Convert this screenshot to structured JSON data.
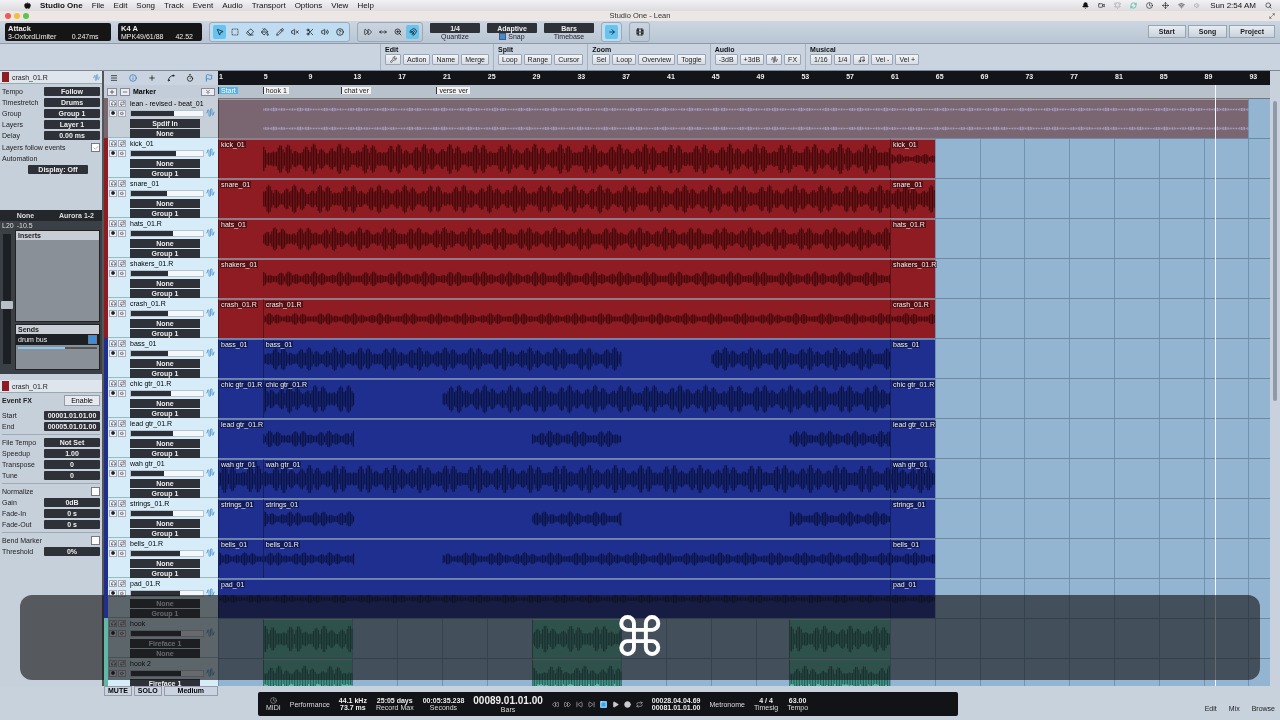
{
  "menu": {
    "app": "Studio One",
    "items": [
      "File",
      "Edit",
      "Song",
      "Track",
      "Event",
      "Audio",
      "Transport",
      "Options",
      "View",
      "Help"
    ],
    "clock": "Sun 2:54 AM"
  },
  "window": {
    "title": "Studio One - Lean"
  },
  "toolbar": {
    "instrument": {
      "name": "Attack",
      "plugin": "3-OxfordLimiter",
      "value": "0.247ms"
    },
    "device": {
      "name": "K4 A",
      "controller": "MPK49/61/88",
      "value": "42.52"
    },
    "tools": [
      {
        "kind": "arrow",
        "selected": true
      },
      {
        "kind": "range",
        "selected": false
      },
      {
        "kind": "split",
        "selected": false
      },
      {
        "kind": "paint",
        "selected": false
      },
      {
        "kind": "pencil",
        "selected": false
      },
      {
        "kind": "mute",
        "selected": false
      },
      {
        "kind": "bend",
        "selected": false
      },
      {
        "kind": "listen",
        "selected": false
      }
    ],
    "edit_tools": [
      {
        "kind": "forward",
        "selected": false
      },
      {
        "kind": "shift",
        "selected": false
      },
      {
        "kind": "zoom",
        "selected": false
      },
      {
        "kind": "follow",
        "selected": true
      }
    ],
    "quantize": {
      "value": "1/4",
      "label": "Quantize"
    },
    "snap": {
      "value": "Adaptive",
      "label": "Snap",
      "on": true
    },
    "timebase": {
      "value": "Bars",
      "label": "Timebase"
    },
    "pages": [
      "Start",
      "Song",
      "Project"
    ]
  },
  "macros": [
    {
      "title": "Edit",
      "buttons": [
        {
          "kind": "wrench"
        },
        {
          "kind": "text",
          "label": "Action"
        },
        {
          "kind": "text",
          "label": "Name"
        },
        {
          "kind": "text",
          "label": "Merge"
        }
      ]
    },
    {
      "title": "Split",
      "buttons": [
        {
          "kind": "text",
          "label": "Loop"
        },
        {
          "kind": "text",
          "label": "Range"
        },
        {
          "kind": "text",
          "label": "Cursor"
        }
      ]
    },
    {
      "title": "Zoom",
      "buttons": [
        {
          "kind": "text",
          "label": "Sel"
        },
        {
          "kind": "text",
          "label": "Loop"
        },
        {
          "kind": "text",
          "label": "Overview"
        },
        {
          "kind": "text",
          "label": "Toggle"
        }
      ]
    },
    {
      "title": "Audio",
      "buttons": [
        {
          "kind": "text",
          "label": "-3dB"
        },
        {
          "kind": "text",
          "label": "+3dB"
        },
        {
          "kind": "wave"
        },
        {
          "kind": "text",
          "label": "FX"
        }
      ]
    },
    {
      "title": "Musical",
      "buttons": [
        {
          "kind": "text",
          "label": "1/16"
        },
        {
          "kind": "text",
          "label": "1/4"
        },
        {
          "kind": "note"
        },
        {
          "kind": "text",
          "label": "Vel -"
        },
        {
          "kind": "text",
          "label": "Vel +"
        }
      ]
    }
  ],
  "inspector": {
    "track_name": "crash_01.R",
    "props": [
      {
        "label": "Tempo",
        "value": "Follow"
      },
      {
        "label": "Timestretch",
        "value": "Drums"
      },
      {
        "label": "Group",
        "value": "Group 1"
      },
      {
        "label": "Layers",
        "value": "Layer 1"
      },
      {
        "label": "Delay",
        "value": "0.00 ms"
      }
    ],
    "layers_follow": {
      "label": "Layers follow events",
      "checked": true
    },
    "automation": "Automation",
    "display": "Display: Off",
    "channel": {
      "input": "None",
      "output": "Aurora 1-2",
      "pan": "L20",
      "volume": "-10.5",
      "level": 0.45,
      "inserts": "Inserts",
      "sends": "Sends",
      "send": {
        "name": "drum bus",
        "on": true,
        "level": 0.6
      }
    },
    "event": {
      "name": "crash_01.R",
      "fx": "Event FX",
      "enable": "Enable",
      "rows": [
        {
          "kind": "value",
          "label": "Start",
          "value": "00001.01.01.00"
        },
        {
          "kind": "value",
          "label": "End",
          "value": "00005.01.01.00"
        },
        {
          "kind": "rule"
        },
        {
          "kind": "value",
          "label": "File Tempo",
          "value": "Not Set"
        },
        {
          "kind": "value",
          "label": "Speedup",
          "value": "1.00"
        },
        {
          "kind": "value",
          "label": "Transpose",
          "value": "0"
        },
        {
          "kind": "value",
          "label": "Tune",
          "value": "0"
        },
        {
          "kind": "rule"
        },
        {
          "kind": "check",
          "label": "Normalize",
          "checked": false
        },
        {
          "kind": "value",
          "label": "Gain",
          "value": "0dB"
        },
        {
          "kind": "value",
          "label": "Fade-In",
          "value": "0 s"
        },
        {
          "kind": "value",
          "label": "Fade-Out",
          "value": "0 s"
        },
        {
          "kind": "rule"
        },
        {
          "kind": "check",
          "label": "Bend Marker",
          "checked": false
        },
        {
          "kind": "value",
          "label": "Threshold",
          "value": "0%"
        }
      ]
    }
  },
  "marker_track": {
    "label": "Marker",
    "markers": [
      "Start",
      "hook 1",
      "chat ver",
      "verse ver"
    ]
  },
  "ruler": [
    "1",
    "5",
    "9",
    "13",
    "17",
    "21",
    "25",
    "29",
    "33",
    "37",
    "41",
    "45",
    "49",
    "53",
    "57",
    "61",
    "65",
    "69",
    "73",
    "77",
    "81",
    "85",
    "89",
    "93"
  ],
  "tracks": [
    {
      "kind": "folder",
      "name": "lean - revised - beat_01",
      "level": 0.6,
      "input": "Spdif In",
      "group": "None",
      "color": "#7a6670"
    },
    {
      "kind": "audio",
      "name": "kick_01",
      "level": 0.62,
      "input": "None",
      "group": "Group 1",
      "color": "#8e1c22",
      "events": [
        "kick_01",
        "kick_01"
      ]
    },
    {
      "kind": "audio",
      "name": "snare_01",
      "level": 0.5,
      "input": "None",
      "group": "Group 1",
      "color": "#8e1c22",
      "events": [
        "snare_01",
        "snare_01"
      ]
    },
    {
      "kind": "audio",
      "name": "hats_01.R",
      "level": 0.58,
      "input": "None",
      "group": "Group 1",
      "color": "#8e1c22",
      "events": [
        "hats_01",
        "hats_01.R"
      ]
    },
    {
      "kind": "audio",
      "name": "shakers_01.R",
      "level": 0.52,
      "input": "None",
      "group": "Group 1",
      "color": "#8e1c22",
      "events": [
        "shakers_01",
        "shakers_01.R"
      ]
    },
    {
      "kind": "audio",
      "name": "crash_01.R",
      "level": 0.52,
      "input": "None",
      "group": "Group 1",
      "color": "#8e1c22",
      "events": [
        "crash_01.R",
        "crash_01.R",
        "crash_01.R"
      ]
    },
    {
      "kind": "audio",
      "name": "bass_01",
      "level": 0.52,
      "input": "None",
      "group": "Group 1",
      "color": "#1f2f8f",
      "events": [
        "bass_01",
        "bass_01",
        "bass_01"
      ]
    },
    {
      "kind": "audio",
      "name": "chic gtr_01.R",
      "level": 0.56,
      "input": "None",
      "group": "Group 1",
      "color": "#1f2f8f",
      "events": [
        "chic gtr_01.R",
        "chic gtr_01.R",
        "chic gtr_01.R"
      ]
    },
    {
      "kind": "audio",
      "name": "lead gtr_01.R",
      "level": 0.58,
      "input": "None",
      "group": "Group 1",
      "color": "#1f2f8f",
      "events": [
        "lead gtr_01.R",
        "lead gtr_01.R"
      ]
    },
    {
      "kind": "audio",
      "name": "wah gtr_01",
      "level": 0.46,
      "input": "None",
      "group": "Group 1",
      "color": "#1f2f8f",
      "events": [
        "wah gtr_01",
        "wah gtr_01",
        "wah gtr_01"
      ]
    },
    {
      "kind": "audio",
      "name": "strings_01.R",
      "level": 0.58,
      "input": "None",
      "group": "Group 1",
      "color": "#1f2f8f",
      "events": [
        "strings_01",
        "strings_01",
        "strings_01"
      ]
    },
    {
      "kind": "audio",
      "name": "bells_01.R",
      "level": 0.68,
      "input": "None",
      "group": "Group 1",
      "color": "#1f2f8f",
      "events": [
        "bells_01",
        "bells_01.R",
        "bells_01"
      ]
    },
    {
      "kind": "audio",
      "name": "pad_01.R",
      "level": 0.68,
      "input": "None",
      "group": "Group 1",
      "color": "#1f2f8f",
      "events": [
        "pad_01",
        "pad_01"
      ]
    },
    {
      "kind": "hook",
      "name": "hook",
      "level": 0.7,
      "input": "Fireface 1",
      "group": "None",
      "color": "#5fb8a8"
    },
    {
      "kind": "hook",
      "name": "hook 2",
      "level": 0.7,
      "input": "Fireface 1",
      "color": "#5fb8a8"
    }
  ],
  "track_footer": {
    "mute": "MUTE",
    "solo": "SOLO",
    "size": "Medium"
  },
  "transport": {
    "midi": "MIDI",
    "performance": "Performance",
    "sample_rate": "44.1 kHz",
    "latency": "73.7 ms",
    "record_max": "25:05 days",
    "record_max_label": "Record Max",
    "seconds": "00:05:35.238",
    "seconds_label": "Seconds",
    "bars": "00089.01.01.00",
    "bars_label": "Bars",
    "loop_start": "00028.04.04.69",
    "loop_end": "00081.01.01.00",
    "metronome": "Metronome",
    "timesig": "4 / 4",
    "timesig_label": "Timesig",
    "tempo": "63.00",
    "tempo_label": "Tempo"
  },
  "views": [
    "Edit",
    "Mix",
    "Browse"
  ],
  "keystroke_overlay": {
    "key": "⌘"
  }
}
